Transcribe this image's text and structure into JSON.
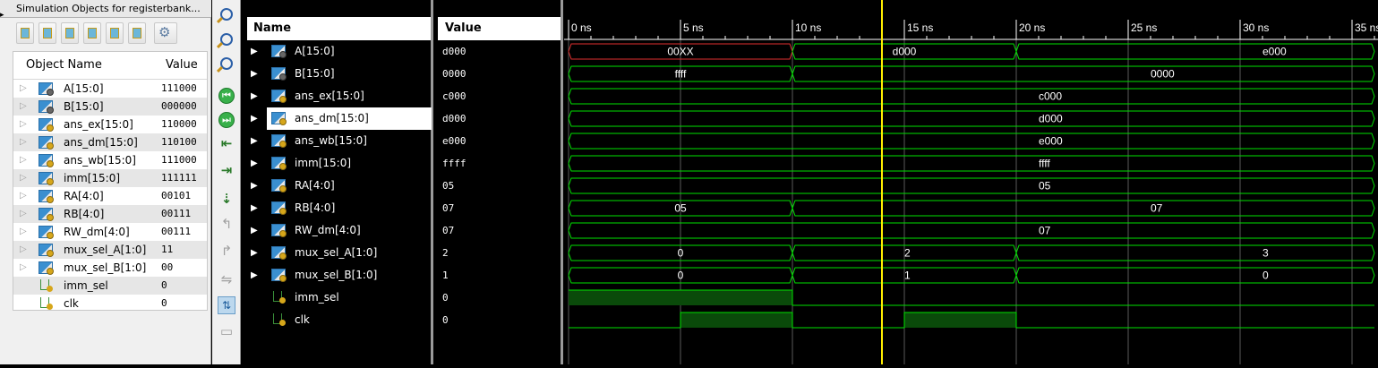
{
  "objects_panel": {
    "title": "Simulation Objects for registerbank...",
    "col_name": "Object Name",
    "col_value": "Value",
    "rows": [
      {
        "name": "A[15:0]",
        "value": "111000",
        "type": "bus",
        "icon": "bus-gray-icon"
      },
      {
        "name": "B[15:0]",
        "value": "000000",
        "type": "bus",
        "icon": "bus-gray-icon"
      },
      {
        "name": "ans_ex[15:0]",
        "value": "110000",
        "type": "bus",
        "icon": "bus-icon"
      },
      {
        "name": "ans_dm[15:0]",
        "value": "110100",
        "type": "bus",
        "icon": "bus-icon"
      },
      {
        "name": "ans_wb[15:0]",
        "value": "111000",
        "type": "bus",
        "icon": "bus-icon"
      },
      {
        "name": "imm[15:0]",
        "value": "111111",
        "type": "bus",
        "icon": "bus-icon"
      },
      {
        "name": "RA[4:0]",
        "value": "00101",
        "type": "bus",
        "icon": "bus-icon"
      },
      {
        "name": "RB[4:0]",
        "value": "00111",
        "type": "bus",
        "icon": "bus-icon"
      },
      {
        "name": "RW_dm[4:0]",
        "value": "00111",
        "type": "bus",
        "icon": "bus-icon"
      },
      {
        "name": "mux_sel_A[1:0]",
        "value": "11",
        "type": "bus",
        "icon": "bus-icon"
      },
      {
        "name": "mux_sel_B[1:0]",
        "value": "00",
        "type": "bus",
        "icon": "bus-icon"
      },
      {
        "name": "imm_sel",
        "value": "0",
        "type": "signal",
        "icon": "signal-icon"
      },
      {
        "name": "clk",
        "value": "0",
        "type": "signal",
        "icon": "signal-icon"
      }
    ]
  },
  "wave_window": {
    "name_header": "Name",
    "value_header": "Value",
    "selected_row": "ans_dm[15:0]",
    "signals": [
      {
        "name": "A[15:0]",
        "value": "d000",
        "type": "bus",
        "icon": "bus-gray-icon"
      },
      {
        "name": "B[15:0]",
        "value": "0000",
        "type": "bus",
        "icon": "bus-gray-icon"
      },
      {
        "name": "ans_ex[15:0]",
        "value": "c000",
        "type": "bus",
        "icon": "bus-icon"
      },
      {
        "name": "ans_dm[15:0]",
        "value": "d000",
        "type": "bus",
        "icon": "bus-icon"
      },
      {
        "name": "ans_wb[15:0]",
        "value": "e000",
        "type": "bus",
        "icon": "bus-icon"
      },
      {
        "name": "imm[15:0]",
        "value": "ffff",
        "type": "bus",
        "icon": "bus-icon"
      },
      {
        "name": "RA[4:0]",
        "value": "05",
        "type": "bus",
        "icon": "bus-icon"
      },
      {
        "name": "RB[4:0]",
        "value": "07",
        "type": "bus",
        "icon": "bus-icon"
      },
      {
        "name": "RW_dm[4:0]",
        "value": "07",
        "type": "bus",
        "icon": "bus-icon"
      },
      {
        "name": "mux_sel_A[1:0]",
        "value": "2",
        "type": "bus",
        "icon": "bus-icon"
      },
      {
        "name": "mux_sel_B[1:0]",
        "value": "1",
        "type": "bus",
        "icon": "bus-icon"
      },
      {
        "name": "imm_sel",
        "value": "0",
        "type": "signal",
        "icon": "signal-icon"
      },
      {
        "name": "clk",
        "value": "0",
        "type": "signal",
        "icon": "signal-icon"
      }
    ],
    "time_unit": "ns",
    "time_ticks": [
      "0 ns",
      "5 ns",
      "10 ns",
      "15 ns",
      "20 ns",
      "25 ns",
      "30 ns",
      "35 ns"
    ],
    "time_tick_values": [
      0,
      5,
      10,
      15,
      20,
      25,
      30,
      35
    ],
    "cursor_time_ns": 14.0,
    "waves": [
      {
        "kind": "bus",
        "segments": [
          {
            "start": 0,
            "end": 10,
            "label": "00XX",
            "error": true
          },
          {
            "start": 10,
            "end": 20,
            "label": "d000"
          },
          {
            "start": 20,
            "end": 36,
            "label": "e000",
            "label_at": 31
          }
        ]
      },
      {
        "kind": "bus",
        "segments": [
          {
            "start": 0,
            "end": 10,
            "label": "ffff"
          },
          {
            "start": 10,
            "end": 36,
            "label": "0000",
            "label_at": 26
          }
        ]
      },
      {
        "kind": "bus",
        "segments": [
          {
            "start": 0,
            "end": 36,
            "label": "c000",
            "label_at": 21
          }
        ]
      },
      {
        "kind": "bus",
        "segments": [
          {
            "start": 0,
            "end": 36,
            "label": "d000",
            "label_at": 21
          }
        ]
      },
      {
        "kind": "bus",
        "segments": [
          {
            "start": 0,
            "end": 36,
            "label": "e000",
            "label_at": 21
          }
        ]
      },
      {
        "kind": "bus",
        "segments": [
          {
            "start": 0,
            "end": 36,
            "label": "ffff",
            "label_at": 21
          }
        ]
      },
      {
        "kind": "bus",
        "segments": [
          {
            "start": 0,
            "end": 36,
            "label": "05",
            "label_at": 21
          }
        ]
      },
      {
        "kind": "bus",
        "segments": [
          {
            "start": 0,
            "end": 10,
            "label": "05"
          },
          {
            "start": 10,
            "end": 36,
            "label": "07",
            "label_at": 26
          }
        ]
      },
      {
        "kind": "bus",
        "segments": [
          {
            "start": 0,
            "end": 36,
            "label": "07",
            "label_at": 21
          }
        ]
      },
      {
        "kind": "bus",
        "segments": [
          {
            "start": 0,
            "end": 10,
            "label": "0"
          },
          {
            "start": 10,
            "end": 20,
            "label": "2",
            "label_at": 15
          },
          {
            "start": 20,
            "end": 36,
            "label": "3",
            "label_at": 31
          }
        ]
      },
      {
        "kind": "bus",
        "segments": [
          {
            "start": 0,
            "end": 10,
            "label": "0"
          },
          {
            "start": 10,
            "end": 20,
            "label": "1",
            "label_at": 15
          },
          {
            "start": 20,
            "end": 36,
            "label": "0",
            "label_at": 31
          }
        ]
      },
      {
        "kind": "bit",
        "levels": [
          {
            "start": 0,
            "end": 10,
            "value": 1
          },
          {
            "start": 10,
            "end": 36,
            "value": 0
          }
        ]
      },
      {
        "kind": "bit",
        "levels": [
          {
            "start": 0,
            "end": 5,
            "value": 0
          },
          {
            "start": 5,
            "end": 10,
            "value": 1
          },
          {
            "start": 10,
            "end": 15,
            "value": 0
          },
          {
            "start": 15,
            "end": 20,
            "value": 1
          },
          {
            "start": 20,
            "end": 36,
            "value": 0
          }
        ]
      }
    ]
  },
  "colors": {
    "wave": "#00e000",
    "wave_fill": "#0a4a0a",
    "error": "#e03030",
    "cursor": "#ffee00",
    "background": "#000000",
    "grid": "#5a5a5a",
    "text": "#ffffff"
  }
}
